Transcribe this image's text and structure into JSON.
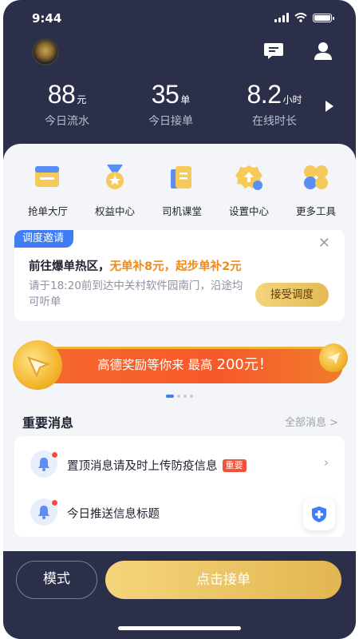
{
  "status_bar": {
    "time": "9:44"
  },
  "stats": [
    {
      "value": "88",
      "unit": "元",
      "label": "今日流水"
    },
    {
      "value": "35",
      "unit": "单",
      "label": "今日接单"
    },
    {
      "value": "8.2",
      "unit": "小时",
      "label": "在线时长"
    }
  ],
  "grid": [
    {
      "label": "抢单大厅",
      "icon": "hall-icon"
    },
    {
      "label": "权益中心",
      "icon": "medal-icon"
    },
    {
      "label": "司机课堂",
      "icon": "book-icon"
    },
    {
      "label": "设置中心",
      "icon": "settings-icon"
    },
    {
      "label": "更多工具",
      "icon": "tools-icon"
    }
  ],
  "dispatch": {
    "tag": "调度邀请",
    "title_prefix": "前往爆单热区，",
    "title_highlight": "无单补8元，起步单补2元",
    "description": "请于18:20前到达中关村软件园南门，沿途均可听单",
    "accept_label": "接受调度"
  },
  "banner": {
    "text": "高德奖励等你来 最高",
    "amount": "200",
    "suffix": "元！"
  },
  "carousel": {
    "count": 4,
    "active": 0
  },
  "messages_section": {
    "title": "重要消息",
    "all_label": "全部消息 >"
  },
  "messages": [
    {
      "text": "置顶消息请及时上传防疫信息",
      "badge": "重要"
    },
    {
      "text": "今日推送信息标题"
    }
  ],
  "actions": {
    "mode_label": "模式",
    "take_order_label": "点击接单"
  },
  "colors": {
    "header_bg": "#2b2f4a",
    "accent_blue": "#3f7cf6",
    "accent_orange": "#f08a1a",
    "gold": "#e4b955",
    "banner_red": "#f7592a"
  }
}
